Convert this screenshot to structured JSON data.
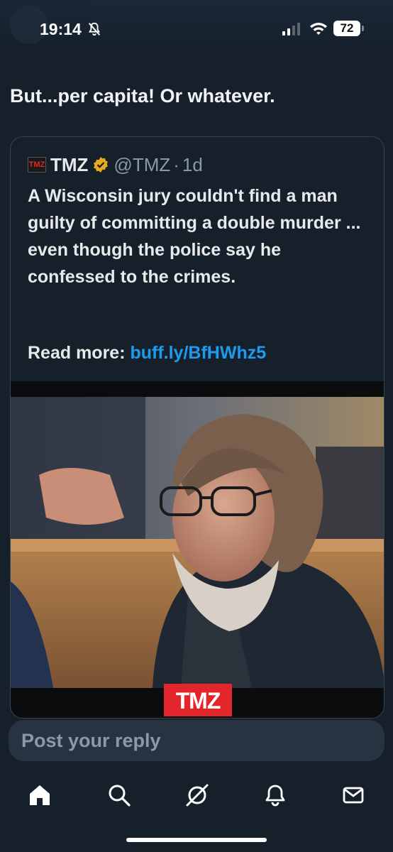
{
  "status_bar": {
    "time": "19:14",
    "battery": "72"
  },
  "tweet": {
    "text": "But...per capita! Or whatever."
  },
  "quote": {
    "avatar_text": "TMZ",
    "name": "TMZ",
    "handle": "@TMZ",
    "separator": "·",
    "time": "1d",
    "body": "A Wisconsin jury couldn't find a man guilty of committing a double murder ... even though the police say he confessed to the crimes.",
    "read_more_label": "Read more: ",
    "link": "buff.ly/BfHWhz5",
    "video_logo": "TMZ"
  },
  "reply": {
    "placeholder": "Post your reply"
  },
  "nav": [
    "home-icon",
    "search-icon",
    "grok-icon",
    "notifications-icon",
    "messages-icon"
  ],
  "colors": {
    "background": "#15202b",
    "link": "#1d9bf0",
    "verified": "#e8a91c",
    "tmz_red": "#e3262b"
  }
}
